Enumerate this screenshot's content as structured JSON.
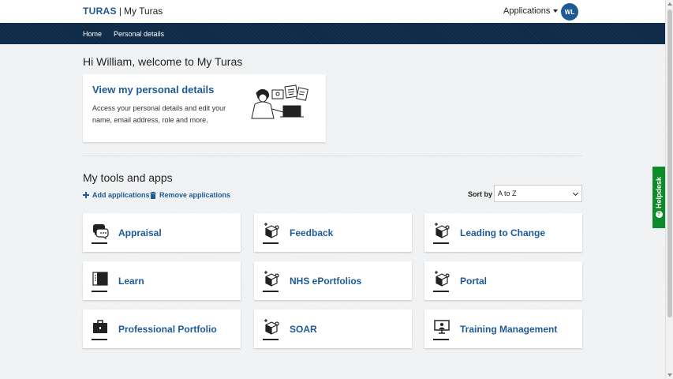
{
  "header": {
    "brand": "TURAS",
    "separator": "|",
    "product": "My Turas",
    "applications_label": "Applications",
    "avatar_initials": "WL"
  },
  "nav": {
    "items": [
      {
        "label": "Home"
      },
      {
        "label": "Personal details"
      }
    ]
  },
  "welcome": "Hi William, welcome to My Turas",
  "details_card": {
    "title": "View my personal details",
    "description": "Access your personal details and edit your name, email address, role and more."
  },
  "tools": {
    "title": "My tools and apps",
    "add_label": "Add applications",
    "remove_label": "Remove applications",
    "sort_label": "Sort by",
    "sort_value": "A to Z",
    "tiles": [
      {
        "label": "Appraisal",
        "icon": "chat-bubbles-icon"
      },
      {
        "label": "Feedback",
        "icon": "cube-sparkle-icon"
      },
      {
        "label": "Leading to Change",
        "icon": "cube-sparkle-icon"
      },
      {
        "label": "Learn",
        "icon": "book-icon"
      },
      {
        "label": "NHS ePortfolios",
        "icon": "cube-sparkle-icon"
      },
      {
        "label": "Portal",
        "icon": "cube-sparkle-icon"
      },
      {
        "label": "Professional Portfolio",
        "icon": "briefcase-icon"
      },
      {
        "label": "SOAR",
        "icon": "cube-sparkle-icon"
      },
      {
        "label": "Training Management",
        "icon": "presentation-icon"
      }
    ]
  },
  "helpdesk": {
    "label": "Helpdesk",
    "icon": "question-circle-icon"
  },
  "colors": {
    "brand_blue": "#1d5a96",
    "nav_dark": "#0e2a47",
    "helpdesk_green": "#0d8a2a"
  }
}
